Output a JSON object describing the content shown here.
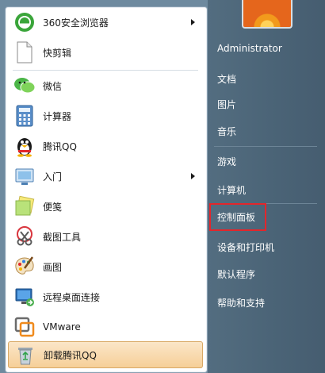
{
  "programs": [
    {
      "label": "360安全浏览器",
      "icon": "360-browser-icon",
      "submenu": true
    },
    {
      "label": "快剪辑",
      "icon": "blank-document-icon",
      "submenu": false
    },
    {
      "label": "微信",
      "icon": "wechat-icon",
      "submenu": false
    },
    {
      "label": "计算器",
      "icon": "calculator-icon",
      "submenu": false
    },
    {
      "label": "腾讯QQ",
      "icon": "qq-penguin-icon",
      "submenu": false
    },
    {
      "label": "入门",
      "icon": "getting-started-icon",
      "submenu": true
    },
    {
      "label": "便笺",
      "icon": "sticky-notes-icon",
      "submenu": false
    },
    {
      "label": "截图工具",
      "icon": "snipping-tool-icon",
      "submenu": false
    },
    {
      "label": "画图",
      "icon": "paint-palette-icon",
      "submenu": false
    },
    {
      "label": "远程桌面连接",
      "icon": "remote-desktop-icon",
      "submenu": false
    },
    {
      "label": "VMware",
      "icon": "vmware-icon",
      "submenu": false
    },
    {
      "label": "卸载腾讯QQ",
      "icon": "recycle-bin-icon",
      "submenu": false,
      "selected": true
    }
  ],
  "right_items": [
    {
      "label": "Administrator"
    },
    {
      "label": "文档"
    },
    {
      "label": "图片"
    },
    {
      "label": "音乐"
    },
    {
      "label": "游戏"
    },
    {
      "label": "计算机"
    },
    {
      "label": "控制面板"
    },
    {
      "label": "设备和打印机"
    },
    {
      "label": "默认程序"
    },
    {
      "label": "帮助和支持"
    }
  ],
  "colors": {
    "highlight": "#e3262b",
    "selected_bg": "#f6cf98",
    "right_panel": "#4a6376"
  }
}
